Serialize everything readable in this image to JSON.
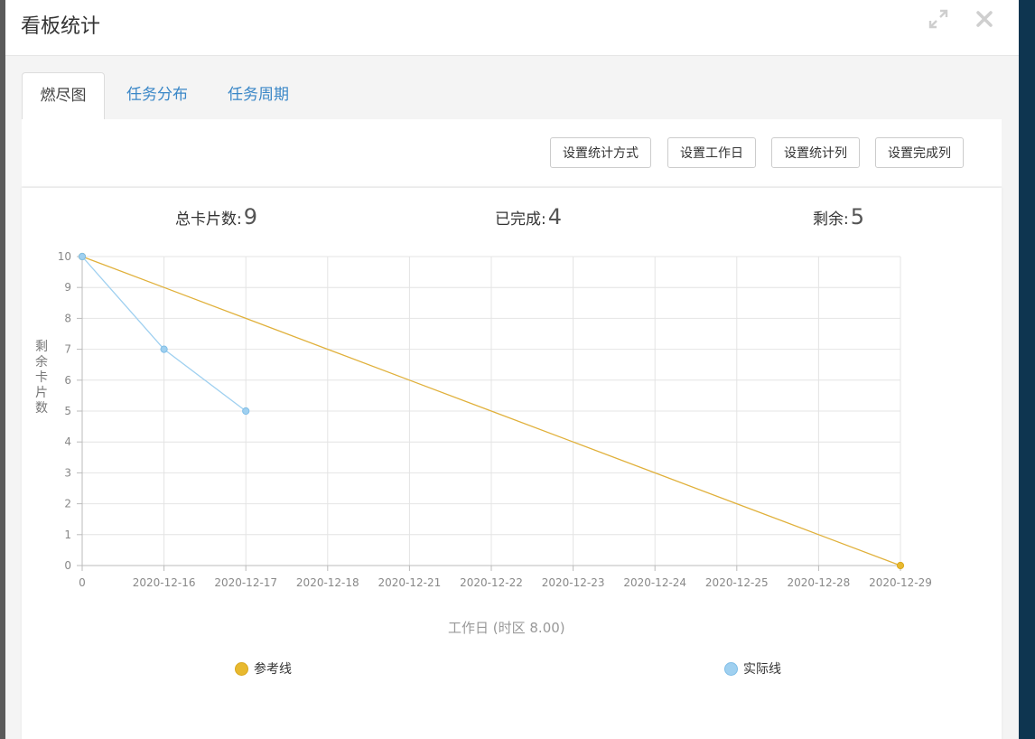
{
  "modal": {
    "title": "看板统计"
  },
  "tabs": [
    {
      "label": "燃尽图",
      "active": true
    },
    {
      "label": "任务分布",
      "active": false
    },
    {
      "label": "任务周期",
      "active": false
    }
  ],
  "toolbar": {
    "buttons": [
      "设置统计方式",
      "设置工作日",
      "设置统计列",
      "设置完成列"
    ]
  },
  "stats": {
    "total_label": "总卡片数:",
    "total_value": "9",
    "done_label": "已完成:",
    "done_value": "4",
    "remaining_label": "剩余:",
    "remaining_value": "5"
  },
  "colors": {
    "reference": "#e8b92f",
    "actual": "#9fd0f0",
    "tab_link": "#3a87c7"
  },
  "chart_data": {
    "type": "line",
    "ylabel": "剩余卡片数",
    "xlabel": "工作日 (时区 8.00)",
    "categories": [
      "0",
      "2020-12-16",
      "2020-12-17",
      "2020-12-18",
      "2020-12-21",
      "2020-12-22",
      "2020-12-23",
      "2020-12-24",
      "2020-12-25",
      "2020-12-28",
      "2020-12-29"
    ],
    "ylim": [
      0,
      10
    ],
    "yticks": [
      0,
      1,
      2,
      3,
      4,
      5,
      6,
      7,
      8,
      9,
      10
    ],
    "grid": true,
    "legend_position": "bottom",
    "series": [
      {
        "name": "参考线",
        "values": [
          10,
          9,
          8,
          7,
          6,
          5,
          4,
          3,
          2,
          1,
          0
        ]
      },
      {
        "name": "实际线",
        "values": [
          10,
          7,
          5
        ]
      }
    ]
  }
}
